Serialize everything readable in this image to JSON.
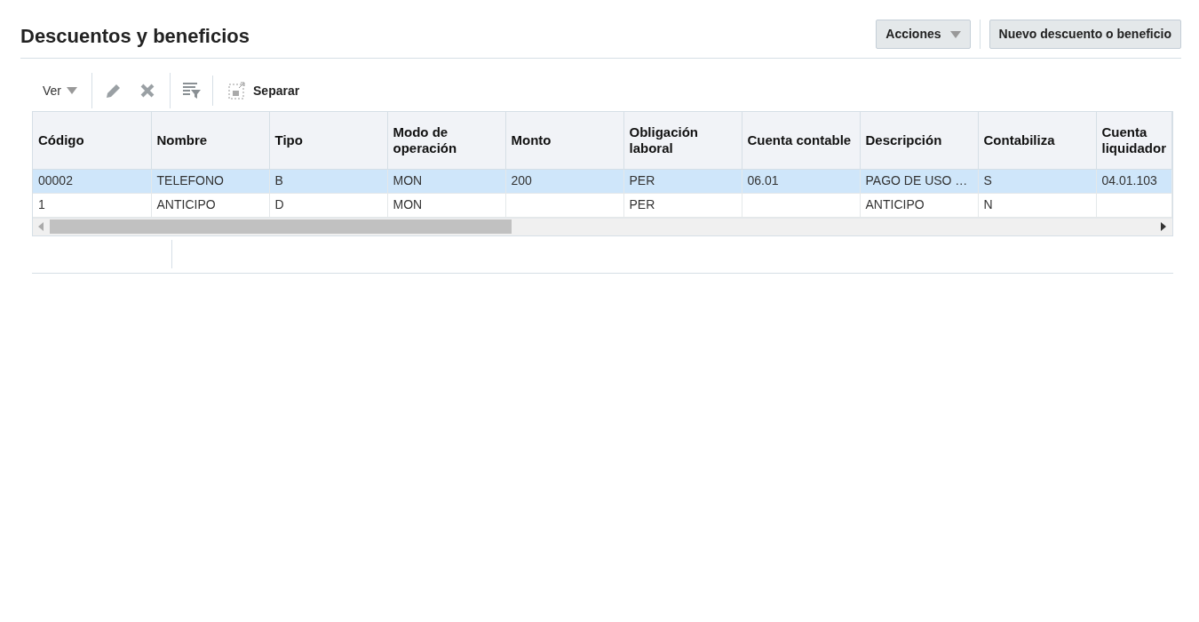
{
  "header": {
    "title": "Descuentos y beneficios",
    "actions_button": "Acciones",
    "new_button": "Nuevo descuento o beneficio"
  },
  "toolbar": {
    "view_menu": "Ver",
    "detach_button": "Separar"
  },
  "table": {
    "columns": [
      "Código",
      "Nombre",
      "Tipo",
      "Modo de operación",
      "Monto",
      "Obligación laboral",
      "Cuenta contable",
      "Descripción",
      "Contabiliza",
      "Cuenta liquidador"
    ],
    "rows": [
      {
        "selected": true,
        "cells": [
          "00002",
          "TELEFONO",
          "B",
          "MON",
          "200",
          "PER",
          "06.01",
          "PAGO DE USO …",
          "S",
          "04.01.103"
        ]
      },
      {
        "selected": false,
        "cells": [
          "1",
          "ANTICIPO",
          "D",
          "MON",
          "",
          "PER",
          "",
          "ANTICIPO",
          "N",
          ""
        ]
      }
    ]
  }
}
